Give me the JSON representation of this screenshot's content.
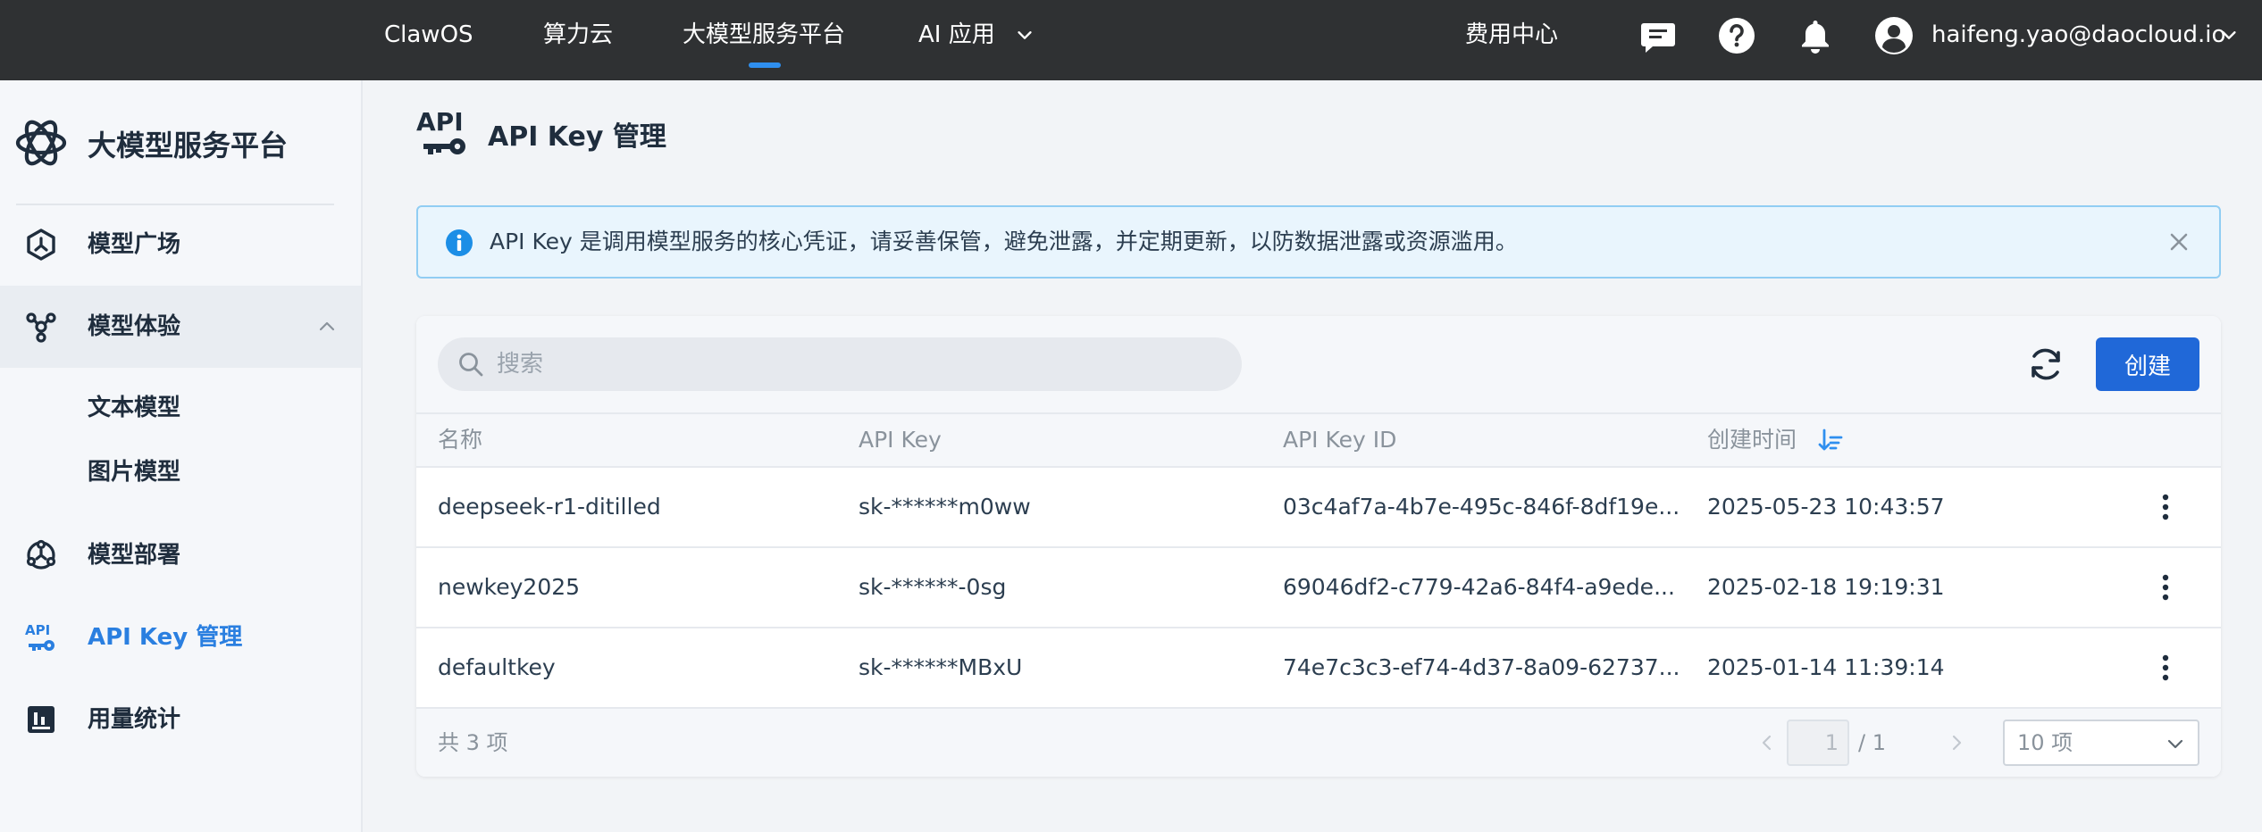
{
  "topnav": {
    "items": [
      "ClawOS",
      "算力云",
      "大模型服务平台",
      "AI 应用"
    ],
    "active": "大模型服务平台",
    "billing": "费用中心",
    "user_email": "haifeng.yao@daocloud.io"
  },
  "sidebar": {
    "brand": "大模型服务平台",
    "items": [
      {
        "label": "模型广场",
        "icon": "model-square-icon"
      },
      {
        "label": "模型体验",
        "icon": "model-experience-icon",
        "expanded": true,
        "children": [
          "文本模型",
          "图片模型"
        ]
      },
      {
        "label": "模型部署",
        "icon": "model-deploy-icon"
      },
      {
        "label": "API Key 管理",
        "icon": "api-key-icon",
        "active": true
      },
      {
        "label": "用量统计",
        "icon": "usage-stats-icon"
      }
    ]
  },
  "page": {
    "title": "API Key 管理"
  },
  "alert": {
    "text": "API Key 是调用模型服务的核心凭证，请妥善保管，避免泄露，并定期更新，以防数据泄露或资源滥用。"
  },
  "toolbar": {
    "search_placeholder": "搜索",
    "create_label": "创建"
  },
  "table": {
    "columns": [
      "名称",
      "API Key",
      "API Key ID",
      "创建时间"
    ],
    "rows": [
      {
        "name": "deepseek-r1-ditilled",
        "key": "sk-******m0ww",
        "key_id": "03c4af7a-4b7e-495c-846f-8df19e...",
        "created": "2025-05-23 10:43:57"
      },
      {
        "name": "newkey2025",
        "key": "sk-******-0sg",
        "key_id": "69046df2-c779-42a6-84f4-a9ede...",
        "created": "2025-02-18 19:19:31"
      },
      {
        "name": "defaultkey",
        "key": "sk-******MBxU",
        "key_id": "74e7c3c3-ef74-4d37-8a09-62737...",
        "created": "2025-01-14 11:39:14"
      }
    ]
  },
  "pagination": {
    "total_text": "共 3 项",
    "current_page": "1",
    "total_pages": "/ 1",
    "page_size": "10 项"
  },
  "colors": {
    "topbar_bg": "#2f3133",
    "accent": "#2068d8",
    "active_indicator": "#2f8fef",
    "alert_bg": "#e9f5fd",
    "alert_border": "#91cdf3"
  }
}
